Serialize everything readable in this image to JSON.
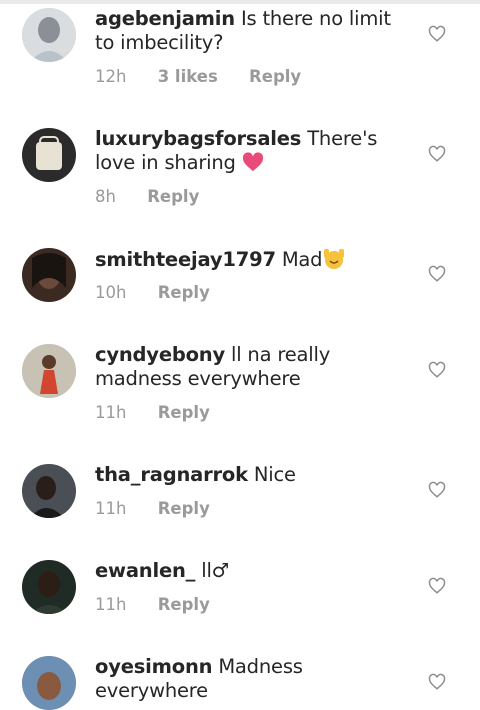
{
  "comments": [
    {
      "user": "agebenjamin",
      "text": "Is there no limit to imbecility?",
      "time": "12h",
      "likes": "3 likes",
      "reply": "Reply"
    },
    {
      "user": "luxurybagsforsales",
      "text": "There's love in sharing",
      "emoji": "heart",
      "time": "8h",
      "reply": "Reply"
    },
    {
      "user": "smithteejay1797",
      "text": "Mad",
      "emoji": "raised-hands",
      "time": "10h",
      "reply": "Reply"
    },
    {
      "user": "cyndyebony",
      "text": "ll na really madness everywhere",
      "time": "11h",
      "reply": "Reply"
    },
    {
      "user": "tha_ragnarrok",
      "text": "Nice",
      "time": "11h",
      "reply": "Reply"
    },
    {
      "user": "ewanlen_",
      "text": "ll♂",
      "time": "11h",
      "reply": "Reply"
    },
    {
      "user": "oyesimonn",
      "text": "Madness everywhere"
    }
  ],
  "colors": {
    "text": "#262626",
    "meta": "#9a9a9a",
    "heart_emoji": "#e84b7a"
  }
}
